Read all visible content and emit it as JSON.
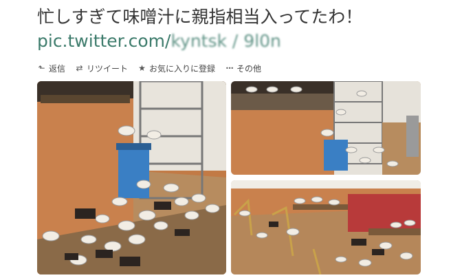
{
  "tweet": {
    "text": "忙しすぎて味噌汁に親指相当入ってたわ！",
    "link_visible": "pic.twitter.com/",
    "link_obscured": "kyntsk / 9l0n"
  },
  "actions": [
    {
      "icon": "reply-icon",
      "glyph": "⬑",
      "label": "返信"
    },
    {
      "icon": "retweet-icon",
      "glyph": "⇄",
      "label": "リツイート"
    },
    {
      "icon": "star-icon",
      "glyph": "★",
      "label": "お気に入りに登録"
    },
    {
      "icon": "more-icon",
      "glyph": "•••",
      "label": "その他"
    }
  ],
  "photos": [
    {
      "name": "photo-1",
      "desc": "left"
    },
    {
      "name": "photo-2",
      "desc": "top-right"
    },
    {
      "name": "photo-3",
      "desc": "bottom-right"
    }
  ],
  "colors": {
    "text": "#333333",
    "link": "#3b7a6a",
    "wood": "#b78c5f",
    "wall": "#c9814d"
  }
}
